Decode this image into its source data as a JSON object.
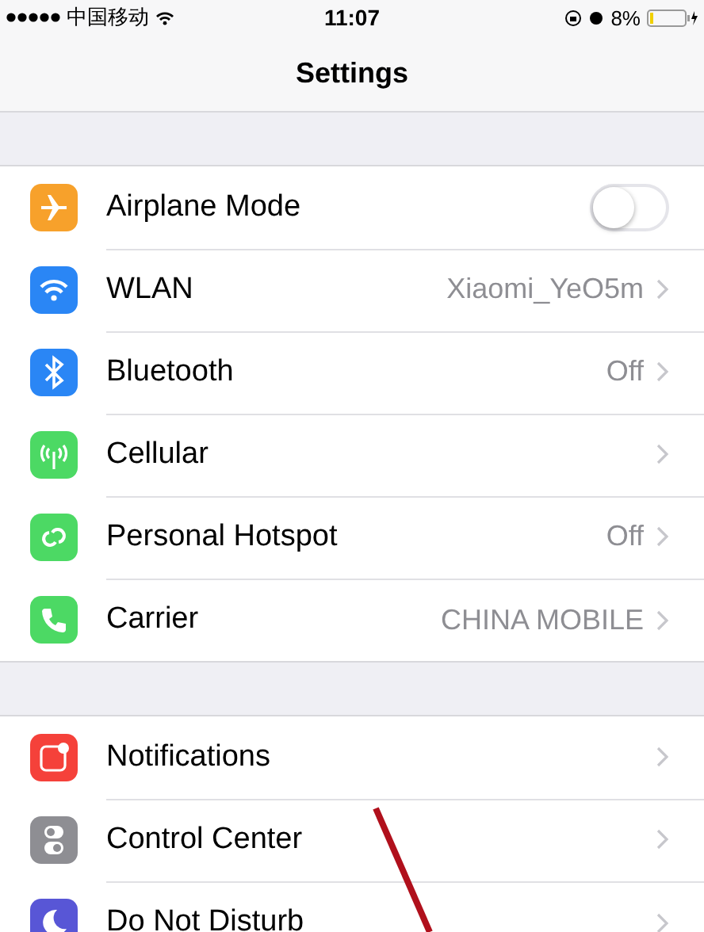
{
  "status_bar": {
    "carrier": "中国移动",
    "time": "11:07",
    "battery": "8%"
  },
  "nav": {
    "title": "Settings"
  },
  "groups": [
    {
      "items": [
        {
          "kind": "toggle",
          "label": "Airplane Mode",
          "on": false
        },
        {
          "kind": "link",
          "label": "WLAN",
          "value": "Xiaomi_YeO5m"
        },
        {
          "kind": "link",
          "label": "Bluetooth",
          "value": "Off"
        },
        {
          "kind": "link",
          "label": "Cellular"
        },
        {
          "kind": "link",
          "label": "Personal Hotspot",
          "value": "Off"
        },
        {
          "kind": "link",
          "label": "Carrier",
          "value": "CHINA MOBILE"
        }
      ]
    },
    {
      "items": [
        {
          "kind": "link",
          "label": "Notifications"
        },
        {
          "kind": "link",
          "label": "Control Center"
        },
        {
          "kind": "link",
          "label": "Do Not Disturb"
        }
      ]
    }
  ]
}
